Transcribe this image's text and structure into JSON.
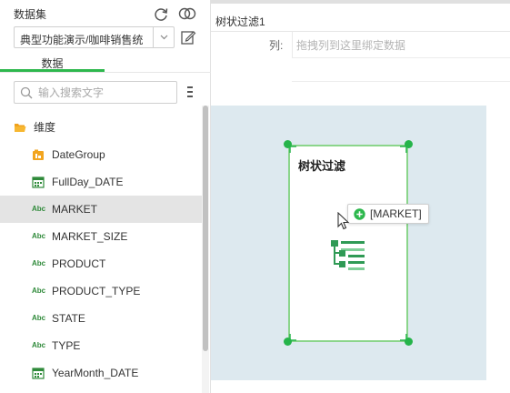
{
  "left_panel": {
    "dataset_title": "数据集",
    "dataset_value": "典型功能演示/咖啡销售统",
    "tab_data": "数据",
    "search_placeholder": "输入搜索文字",
    "tree": {
      "root": {
        "label": "维度",
        "icon": "folder-open-icon"
      },
      "items": [
        {
          "label": "DateGroup",
          "icon": "date-group-icon"
        },
        {
          "label": "FullDay_DATE",
          "icon": "calendar-icon"
        },
        {
          "label": "MARKET",
          "icon": "abc-text-icon",
          "selected": true
        },
        {
          "label": "MARKET_SIZE",
          "icon": "abc-text-icon"
        },
        {
          "label": "PRODUCT",
          "icon": "abc-text-icon"
        },
        {
          "label": "PRODUCT_TYPE",
          "icon": "abc-text-icon"
        },
        {
          "label": "STATE",
          "icon": "abc-text-icon"
        },
        {
          "label": "TYPE",
          "icon": "abc-text-icon"
        },
        {
          "label": "YearMonth_DATE",
          "icon": "calendar-icon"
        }
      ],
      "abc_glyph": "Abc"
    }
  },
  "right_panel": {
    "component_title": "树状过滤1",
    "column_label": "列:",
    "column_placeholder": "拖拽列到这里绑定数据",
    "widget_title": "树状过滤",
    "drag_tooltip": "[MARKET]"
  },
  "colors": {
    "accent_green": "#2db84d",
    "canvas_bg": "#dde9ef",
    "selected_row": "#e4e4e4",
    "widget_border": "#8bd58b"
  }
}
